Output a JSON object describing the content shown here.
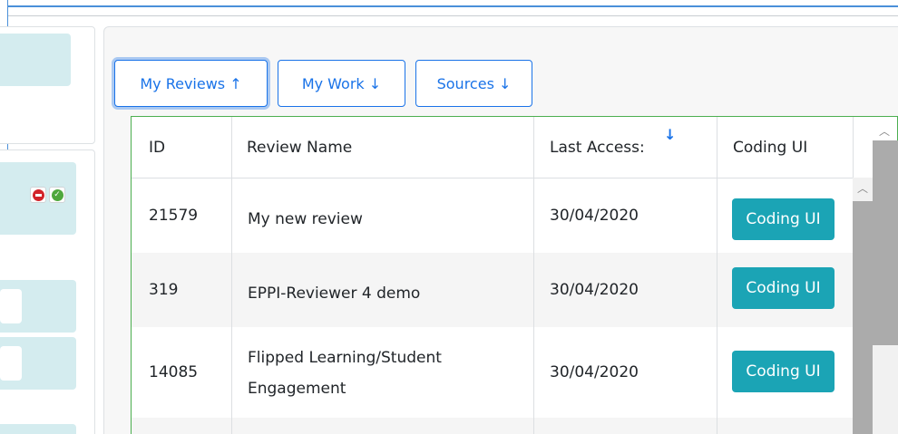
{
  "tabs": [
    {
      "label": "My Reviews ↑",
      "active": true
    },
    {
      "label": "My Work ↓",
      "active": false
    },
    {
      "label": "Sources ↓",
      "active": false
    }
  ],
  "table": {
    "headers": {
      "id": "ID",
      "name": "Review Name",
      "last_access": "Last Access:",
      "coding_ui": "Coding UI"
    },
    "sort_icon": "arrow-down-icon",
    "rows": [
      {
        "id": "21579",
        "name": "My new review",
        "name_line2": "",
        "last_access": "30/04/2020",
        "action": "Coding UI"
      },
      {
        "id": "319",
        "name": "EPPI-Reviewer 4 demo",
        "name_line2": "",
        "last_access": "30/04/2020",
        "action": "Coding UI"
      },
      {
        "id": "14085",
        "name": "Flipped Learning/Student",
        "name_line2": "Engagement",
        "last_access": "30/04/2020",
        "action": "Coding UI"
      }
    ]
  },
  "colors": {
    "accent": "#1a73e8",
    "coding_button": "#1ba4b5",
    "grid_border": "#4caf50",
    "panel_teal": "#d4ecef"
  },
  "icons": [
    "stop-icon",
    "check-icon",
    "scroll-up-icon"
  ]
}
